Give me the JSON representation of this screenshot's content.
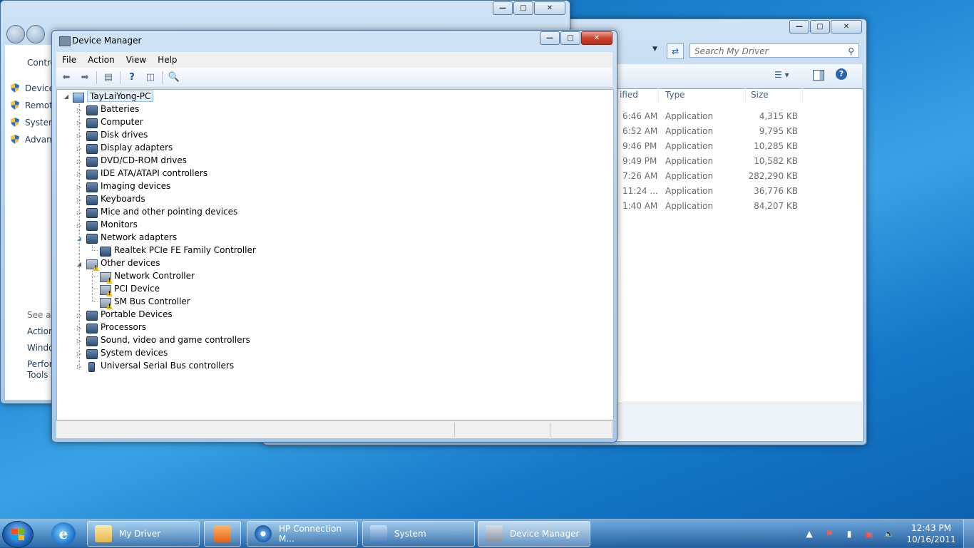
{
  "explorer": {
    "search_placeholder": "Search My Driver",
    "columns": [
      "ified",
      "Type",
      "Size"
    ],
    "rows": [
      {
        "time": "6:46 AM",
        "type": "Application",
        "size": "4,315 KB"
      },
      {
        "time": "6:52 AM",
        "type": "Application",
        "size": "9,795 KB"
      },
      {
        "time": "9:46 PM",
        "type": "Application",
        "size": "10,285 KB"
      },
      {
        "time": "9:49 PM",
        "type": "Application",
        "size": "10,582 KB"
      },
      {
        "time": "7:26 AM",
        "type": "Application",
        "size": "282,290 KB"
      },
      {
        "time": "11:24 ...",
        "type": "Application",
        "size": "36,776 KB"
      },
      {
        "time": "1:40 AM",
        "type": "Application",
        "size": "84,207 KB"
      }
    ]
  },
  "control_panel": {
    "partial_header": "Contro",
    "items": [
      "Device",
      "Remot",
      "Systen",
      "Advan"
    ],
    "see_also": "See als",
    "links": [
      "Action",
      "Windo",
      "Perfor",
      "Tools"
    ]
  },
  "device_manager": {
    "title": "Device Manager",
    "menu": [
      "File",
      "Action",
      "View",
      "Help"
    ],
    "root": "TayLaiYong-PC",
    "categories": [
      "Batteries",
      "Computer",
      "Disk drives",
      "Display adapters",
      "DVD/CD-ROM drives",
      "IDE ATA/ATAPI controllers",
      "Imaging devices",
      "Keyboards",
      "Mice and other pointing devices",
      "Monitors",
      "Network adapters"
    ],
    "network_child": "Realtek PCIe FE Family Controller",
    "other_devices": "Other devices",
    "other_children": [
      "Network Controller",
      "PCI Device",
      "SM Bus Controller"
    ],
    "categories_after": [
      "Portable Devices",
      "Processors",
      "Sound, video and game controllers",
      "System devices",
      "Universal Serial Bus controllers"
    ]
  },
  "taskbar": {
    "buttons": [
      "My Driver",
      "HP Connection M...",
      "System",
      "Device Manager"
    ],
    "time": "12:43 PM",
    "date": "10/16/2011"
  }
}
